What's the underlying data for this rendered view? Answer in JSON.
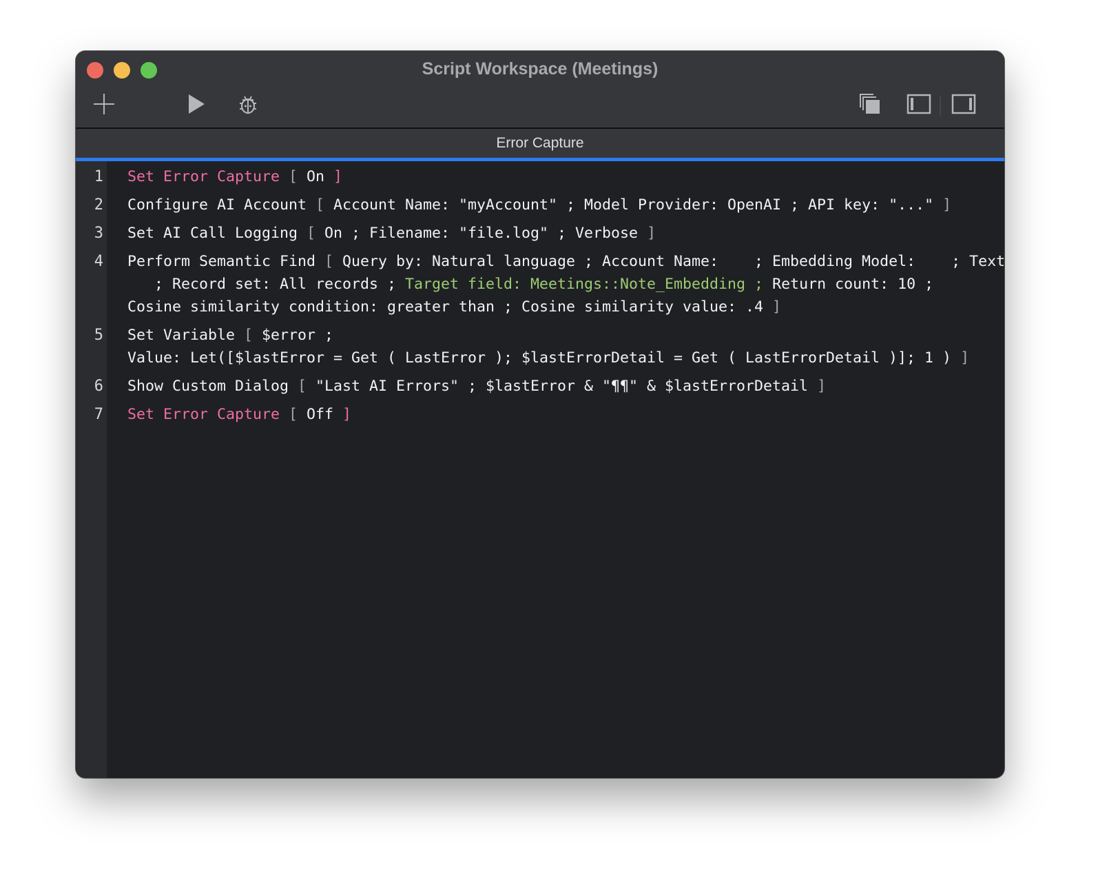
{
  "window": {
    "title": "Script Workspace (Meetings)"
  },
  "toolbar": {
    "new": "new-script",
    "run": "run-script",
    "debug": "debug-script"
  },
  "tab": {
    "label": "Error Capture"
  },
  "colors": {
    "accent": "#2f7af0",
    "control": "#ee6ea3",
    "field": "#9ccc74"
  },
  "steps": [
    {
      "n": "1",
      "rows": [
        [
          [
            "p",
            "Set Error Capture "
          ],
          [
            "b",
            "[ "
          ],
          [
            "k",
            "On "
          ],
          [
            "p",
            "]"
          ]
        ]
      ]
    },
    {
      "n": "2",
      "rows": [
        [
          [
            "k",
            "Configure AI Account "
          ],
          [
            "b",
            "[ "
          ],
          [
            "k",
            "Account Name: \"myAccount\" ; Model Provider: OpenAI ; API key: \"...\" "
          ],
          [
            "b",
            "]"
          ]
        ]
      ]
    },
    {
      "n": "3",
      "rows": [
        [
          [
            "k",
            "Set AI Call Logging "
          ],
          [
            "b",
            "[ "
          ],
          [
            "k",
            "On ; Filename: \"file.log\" ; Verbose "
          ],
          [
            "b",
            "]"
          ]
        ]
      ]
    },
    {
      "n": "4",
      "rows": [
        [
          [
            "k",
            "Perform Semantic Find "
          ],
          [
            "b",
            "[ "
          ],
          [
            "k",
            "Query by: Natural language ; Account Name:    ; Embedding Model:    ; Text:"
          ]
        ],
        [
          [
            "k",
            "   ; Record set: All records ; "
          ],
          [
            "g",
            "Target field: Meetings::Note_Embedding ; "
          ],
          [
            "k",
            "Return count: 10 ;"
          ]
        ],
        [
          [
            "k",
            "Cosine similarity condition: greater than ; Cosine similarity value: .4 "
          ],
          [
            "b",
            "]"
          ]
        ]
      ]
    },
    {
      "n": "5",
      "rows": [
        [
          [
            "k",
            "Set Variable "
          ],
          [
            "b",
            "[ "
          ],
          [
            "k",
            "$error ;"
          ]
        ],
        [
          [
            "k",
            "Value: Let([$lastError = Get ( LastError ); $lastErrorDetail = Get ( LastErrorDetail )]; 1 ) "
          ],
          [
            "b",
            "]"
          ]
        ]
      ]
    },
    {
      "n": "6",
      "rows": [
        [
          [
            "k",
            "Show Custom Dialog "
          ],
          [
            "b",
            "[ "
          ],
          [
            "k",
            "\"Last AI Errors\" ; $lastError & \"¶¶\" & $lastErrorDetail "
          ],
          [
            "b",
            "]"
          ]
        ]
      ]
    },
    {
      "n": "7",
      "rows": [
        [
          [
            "p",
            "Set Error Capture "
          ],
          [
            "b",
            "[ "
          ],
          [
            "k",
            "Off "
          ],
          [
            "p",
            "]"
          ]
        ]
      ]
    }
  ]
}
